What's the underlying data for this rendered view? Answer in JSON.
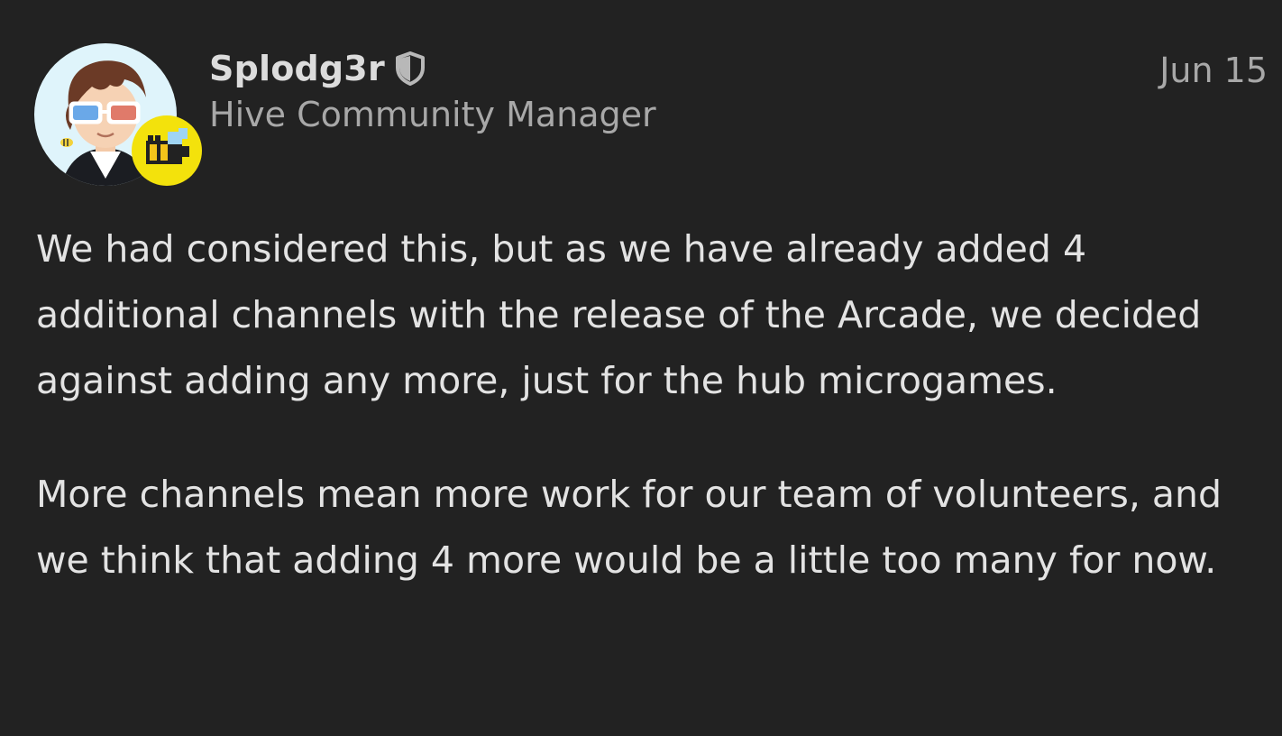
{
  "post": {
    "author": {
      "username": "Splodg3r",
      "title": "Hive Community Manager",
      "avatar_icon": "user-avatar",
      "flair_icon": "bee-flair-icon",
      "badge_icon": "shield-icon"
    },
    "date": "Jun 15",
    "paragraphs": [
      "We had considered this, but as we have already added 4 additional channels with the release of the Arcade, we decided against adding any more, just for the hub microgames.",
      "More channels mean more work for our team of volunteers, and we think that adding 4 more would be a little too many for now."
    ]
  },
  "colors": {
    "background": "#222222",
    "text": "#e3e3e3",
    "muted": "#a8a8a8",
    "flair_yellow": "#f3e20c"
  }
}
